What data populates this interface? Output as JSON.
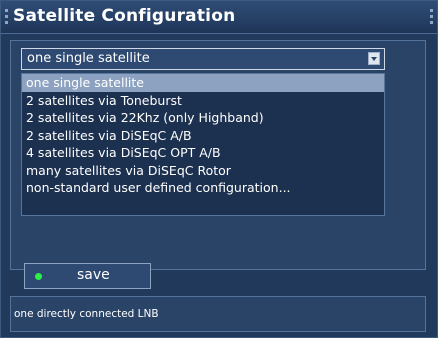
{
  "window": {
    "title": "Satellite Configuration"
  },
  "select": {
    "value": "one single satellite",
    "options": [
      "one single satellite",
      "2 satellites via Toneburst",
      "2 satellites via 22Khz (only Highband)",
      "2 satellites via DiSEqC A/B",
      "4 satellites via DiSEqC OPT A/B",
      "many satellites via DiSEqC Rotor",
      "non-standard user defined configuration..."
    ],
    "selected_index": 0
  },
  "save": {
    "label": "save",
    "indicator_color": "#2cf04a"
  },
  "status": {
    "text": "one directly connected LNB"
  }
}
